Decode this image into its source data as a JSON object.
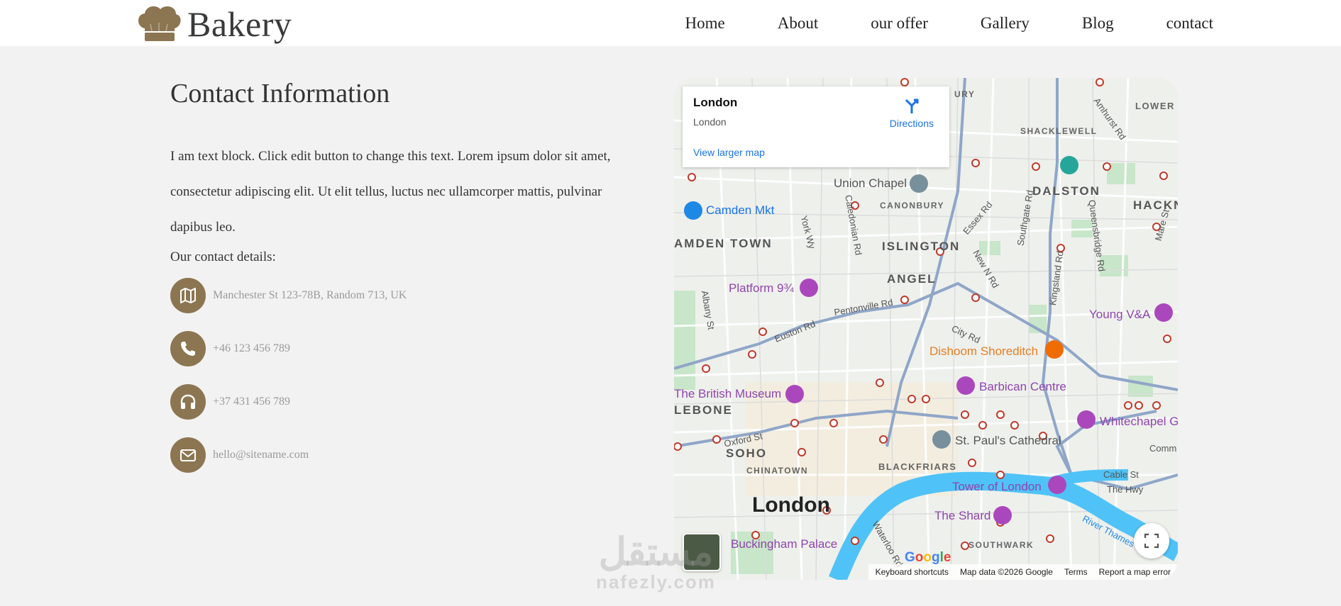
{
  "brand": {
    "name": "Bakery",
    "logo_icon": "chef-hat-icon",
    "logo_color": "#8c7651"
  },
  "nav": {
    "items": [
      "Home",
      "About",
      "our offer",
      "Gallery",
      "Blog",
      "contact"
    ]
  },
  "contact": {
    "heading": "Contact Information",
    "paragraph": "I am text block. Click edit button to change this text. Lorem ipsum dolor sit amet, consectetur adipiscing elit. Ut elit tellus, luctus nec ullamcorper mattis, pulvinar dapibus leo.",
    "details_label": "Our contact details:",
    "items": [
      {
        "icon": "map-icon",
        "text": "Manchester St 123-78B, Random 713, UK"
      },
      {
        "icon": "phone-icon",
        "text": "+46 123 456 789"
      },
      {
        "icon": "headphones-icon",
        "text": "+37 431 456 789"
      },
      {
        "icon": "envelope-icon",
        "text": "hello@sitename.com"
      }
    ],
    "icon_bg": "#8c7651"
  },
  "map": {
    "card": {
      "title": "London",
      "subtitle": "London",
      "directions": "Directions",
      "larger_map": "View larger map"
    },
    "labels": {
      "union_chapel": "Union Chapel",
      "camden_mkt": "Camden Mkt",
      "dalston": "DALSTON",
      "hackney": "HACKN",
      "camden_town": "AMDEN TOWN",
      "islington": "ISLINGTON",
      "angel": "ANGEL",
      "platform": "Platform 9¾",
      "young_va": "Young V&A",
      "dishoom": "Dishoom Shoreditch",
      "british_museum": "The British Museum",
      "barbican": "Barbican Centre",
      "lebone": "LEBONE",
      "whitechapel": "Whitechapel G",
      "st_pauls": "St. Paul's Cathedral",
      "soho": "SOHO",
      "chinatown": "CHINATOWN",
      "blackfriars": "BLACKFRIARS",
      "tower": "Tower of London",
      "london": "London",
      "shard": "The Shard",
      "buckingham": "Buckingham Palace",
      "southwark": "SOUTHWARK",
      "shacklewell": "SHACKLEWELL",
      "canonbury": "CANONBURY",
      "lower_cl": "LOWER CLA",
      "oxford_st": "Oxford St",
      "euston_rd": "Euston Rd",
      "pentonville_rd": "Pentonville Rd",
      "city_rd": "City Rd",
      "caledonian_rd": "Caledonian Rd",
      "kingsland_rd": "Kingsland Rd",
      "essex_rd": "Essex Rd",
      "new_n_rd": "New N Rd",
      "cable_st": "Cable St",
      "the_hwy": "The Hwy",
      "river_thames": "River Thames",
      "amhurst_rd": "Amhurst Rd",
      "albany_st": "Albany St",
      "york_wy": "York Wy",
      "southgate_rd": "Southgate Rd",
      "queensbridge_rd": "Queensbridge Rd",
      "mare_st": "Mare St",
      "waterloo_rd": "Waterloo Rd",
      "comm": "Comm",
      "ury": "URY"
    },
    "google": "Google",
    "footer": [
      "Keyboard shortcuts",
      "Map data ©2026 Google",
      "Terms",
      "Report a map error"
    ],
    "colors": {
      "river": "#4fc3f7",
      "major_road": "#8fa6c8",
      "park": "#c8e6c9",
      "poi_purple": "#8e44ad"
    }
  },
  "watermark": {
    "line1": "مستقل",
    "line2": "nafezly.com"
  }
}
